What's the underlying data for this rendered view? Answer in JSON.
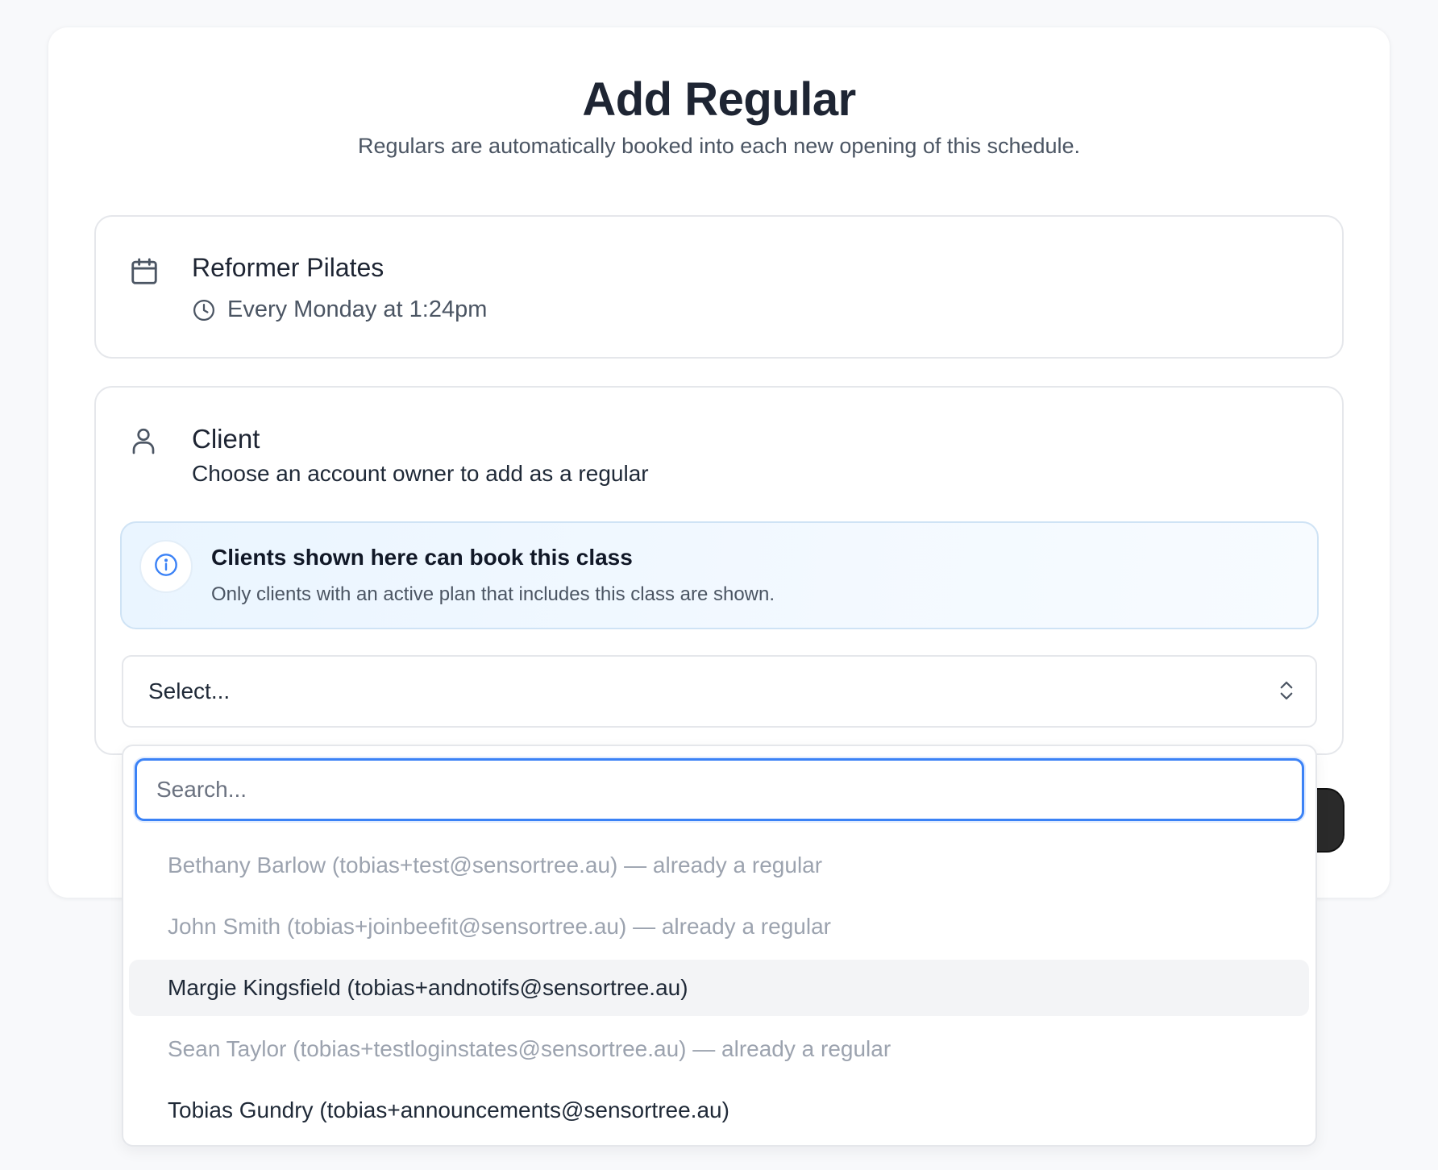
{
  "header": {
    "title": "Add Regular",
    "subtitle": "Regulars are automatically booked into each new opening of this schedule."
  },
  "class_info": {
    "icon": "calendar-icon",
    "name": "Reformer Pilates",
    "time_icon": "clock-icon",
    "schedule": "Every Monday at 1:24pm"
  },
  "client_section": {
    "icon": "user-icon",
    "label": "Client",
    "description": "Choose an account owner to add as a regular"
  },
  "info_notice": {
    "icon": "info-icon",
    "title": "Clients shown here can book this class",
    "text": "Only clients with an active plan that includes this class are shown."
  },
  "select": {
    "value": "Select...",
    "icon": "chevron-up-down-icon"
  },
  "search": {
    "placeholder": "Search...",
    "value": ""
  },
  "options": [
    {
      "label": "Bethany Barlow (tobias+test@sensortree.au) — already a regular",
      "disabled": true,
      "highlighted": false
    },
    {
      "label": "John Smith (tobias+joinbeefit@sensortree.au) — already a regular",
      "disabled": true,
      "highlighted": false
    },
    {
      "label": "Margie Kingsfield (tobias+andnotifs@sensortree.au)",
      "disabled": false,
      "highlighted": true
    },
    {
      "label": "Sean Taylor (tobias+testloginstates@sensortree.au) — already a regular",
      "disabled": true,
      "highlighted": false
    },
    {
      "label": "Tobias Gundry (tobias+announcements@sensortree.au)",
      "disabled": false,
      "highlighted": false
    }
  ],
  "colors": {
    "accent": "#3b82f6",
    "info_bg": "#eaf5ff",
    "disabled_text": "#9ca3af",
    "highlight_bg": "#f3f4f6"
  }
}
